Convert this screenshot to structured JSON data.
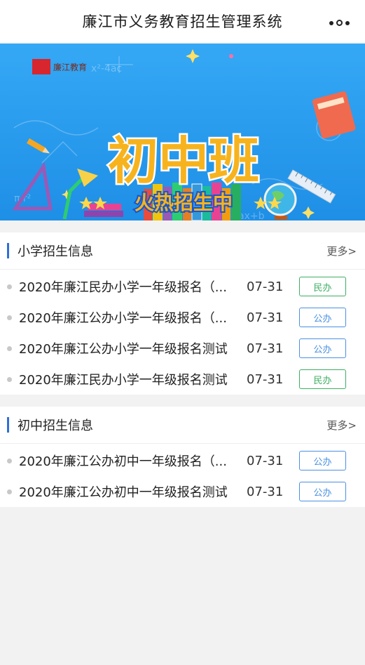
{
  "header": {
    "title": "廉江市义务教育招生管理系统"
  },
  "banner": {
    "logo_text": "廉江教育",
    "headline": "初中班",
    "subline": "火热招生中",
    "colors": {
      "background": "#2ea0f0",
      "headline": "#f7b31e",
      "ribbon": "#1a56c9"
    }
  },
  "primary": {
    "title": "小学招生信息",
    "more": "更多>",
    "items": [
      {
        "title": "2020年廉江民办小学一年级报名（...",
        "date": "07-31",
        "tag": "民办"
      },
      {
        "title": "2020年廉江公办小学一年级报名（...",
        "date": "07-31",
        "tag": "公办"
      },
      {
        "title": "2020年廉江公办小学一年级报名测试",
        "date": "07-31",
        "tag": "公办"
      },
      {
        "title": "2020年廉江民办小学一年级报名测试",
        "date": "07-31",
        "tag": "民办"
      }
    ]
  },
  "junior": {
    "title": "初中招生信息",
    "more": "更多>",
    "items": [
      {
        "title": "2020年廉江公办初中一年级报名（...",
        "date": "07-31",
        "tag": "公办"
      },
      {
        "title": "2020年廉江公办初中一年级报名测试",
        "date": "07-31",
        "tag": "公办"
      }
    ]
  },
  "colors": {
    "accent": "#2f6fd8",
    "tag_private": "#3cae62",
    "tag_public": "#4a90e2"
  }
}
